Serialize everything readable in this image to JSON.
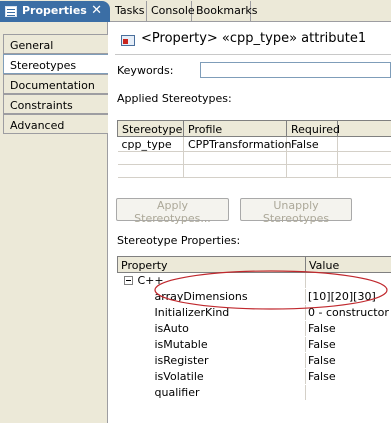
{
  "tabs": {
    "properties": "Properties",
    "tasks": "Tasks",
    "console": "Console",
    "bookmarks": "Bookmarks"
  },
  "nav": {
    "items": [
      "General",
      "Stereotypes",
      "Documentation",
      "Constraints",
      "Advanced"
    ],
    "selected": "Stereotypes"
  },
  "header": {
    "title": "<Property> «cpp_type» attribute1"
  },
  "keywords": {
    "label": "Keywords:",
    "value": ""
  },
  "applied": {
    "label": "Applied Stereotypes:",
    "columns": [
      "Stereotype",
      "Profile",
      "Required"
    ],
    "rows": [
      {
        "stereotype": "cpp_type",
        "profile": "CPPTransformation",
        "required": "False"
      }
    ]
  },
  "buttons": {
    "apply": "Apply Stereotypes...",
    "unapply": "Unapply Stereotypes"
  },
  "stereo_props": {
    "label": "Stereotype Properties:",
    "columns": [
      "Property",
      "Value"
    ],
    "group": "C++",
    "rows": [
      {
        "property": "arrayDimensions",
        "value": "[10][20][30]"
      },
      {
        "property": "InitializerKind",
        "value": "0 - constructor"
      },
      {
        "property": "isAuto",
        "value": "False"
      },
      {
        "property": "isMutable",
        "value": "False"
      },
      {
        "property": "isRegister",
        "value": "False"
      },
      {
        "property": "isVolatile",
        "value": "False"
      },
      {
        "property": "qualifier",
        "value": ""
      }
    ]
  },
  "annotation": {
    "color": "#c0282d"
  }
}
